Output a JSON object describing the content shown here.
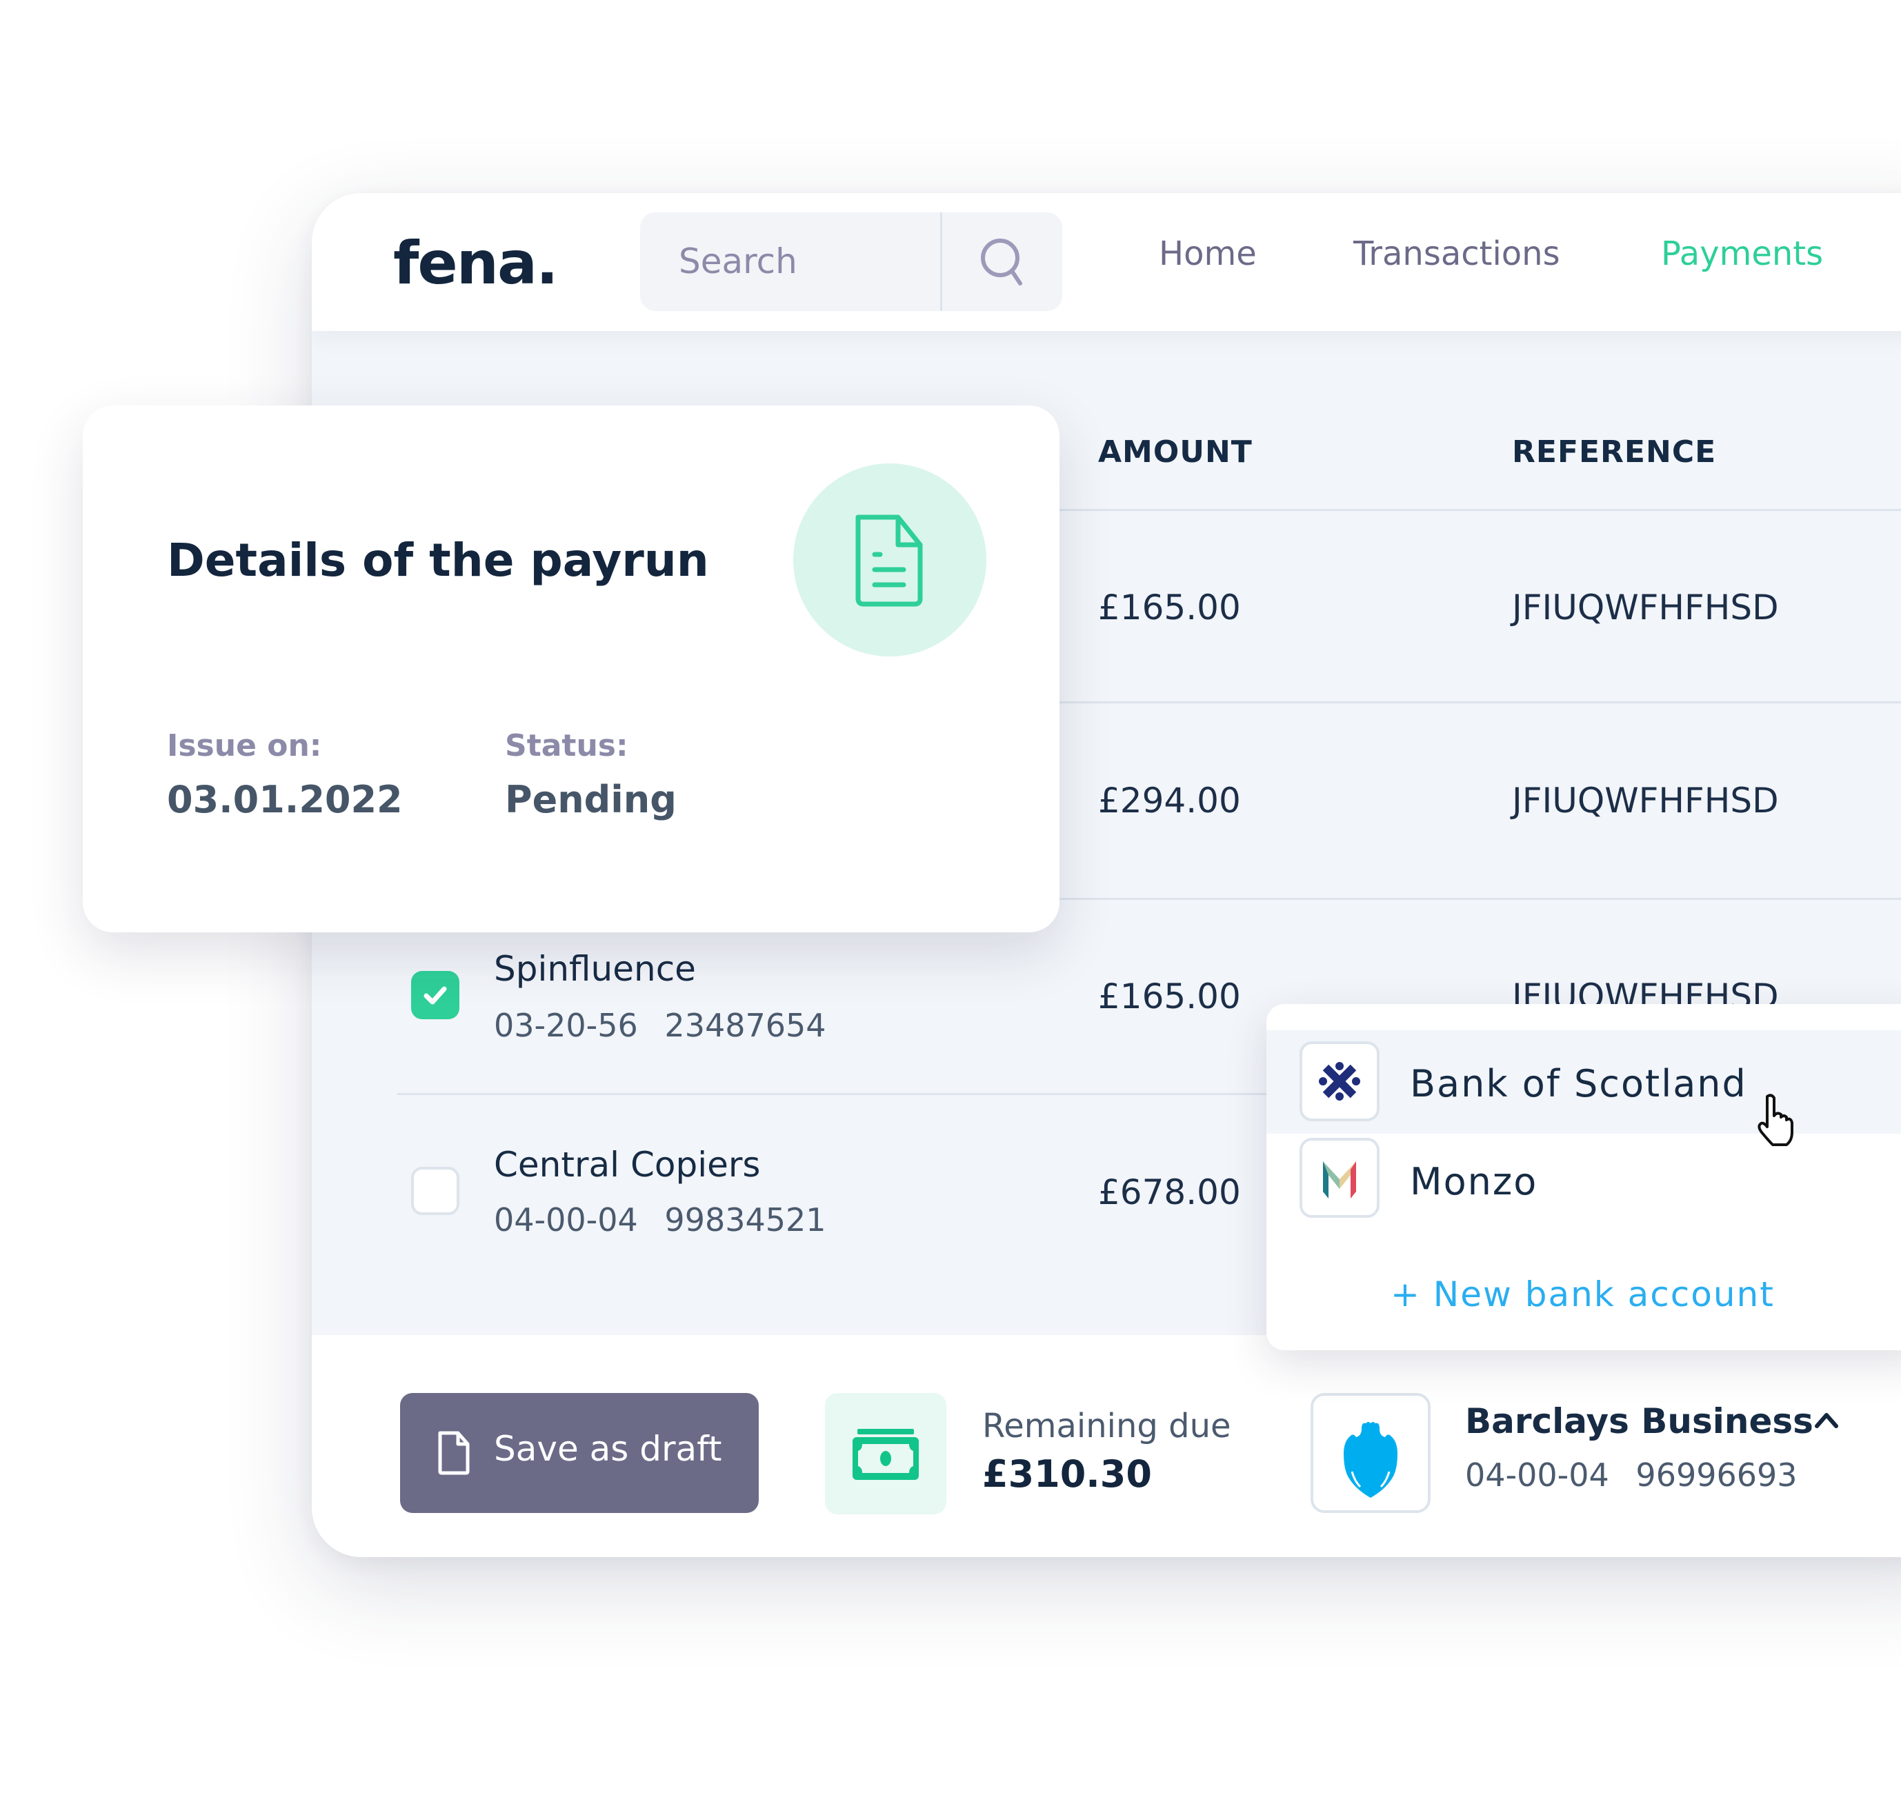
{
  "app": {
    "logo": "fena.",
    "search": {
      "placeholder": "Search",
      "value": ""
    },
    "nav": [
      {
        "label": "Home",
        "active": false
      },
      {
        "label": "Transactions",
        "active": false
      },
      {
        "label": "Payments",
        "active": true
      }
    ]
  },
  "table": {
    "columns": [
      "AMOUNT",
      "REFERENCE"
    ],
    "rows": [
      {
        "amount": "£165.00",
        "reference": "JFIUQWFHFHSD"
      },
      {
        "amount": "£294.00",
        "reference": "JFIUQWFHFHSD"
      },
      {
        "name": "Spinfluence",
        "sort_code": "03-20-56",
        "account": "23487654",
        "amount": "£165.00",
        "reference": "JFIUQWFHFHSD",
        "checked": true
      },
      {
        "name": "Central Copiers",
        "sort_code": "04-00-04",
        "account": "99834521",
        "amount": "£678.00",
        "checked": false
      }
    ]
  },
  "details": {
    "title": "Details of the payrun",
    "issue_label": "Issue on:",
    "issue_value": "03.01.2022",
    "status_label": "Status:",
    "status_value": "Pending"
  },
  "dropdown": {
    "items": [
      {
        "label": "Bank of Scotland",
        "icon": "bank-of-scotland-logo",
        "hovered": true
      },
      {
        "label": "Monzo",
        "icon": "monzo-logo",
        "hovered": false
      }
    ],
    "new_account": "+ New bank account"
  },
  "footer": {
    "save_label": "Save as draft",
    "remaining_label": "Remaining due",
    "remaining_value": "£310.30",
    "bank_name": "Barclays Business",
    "bank_sort_code": "04-00-04",
    "bank_account": "96996693"
  },
  "colors": {
    "accent": "#2ecf98",
    "link": "#2aaef0",
    "dark": "#13263d",
    "save_button": "#6b6b88",
    "barclays": "#00aeef",
    "bank_of_scotland": "#1f2d7a"
  }
}
